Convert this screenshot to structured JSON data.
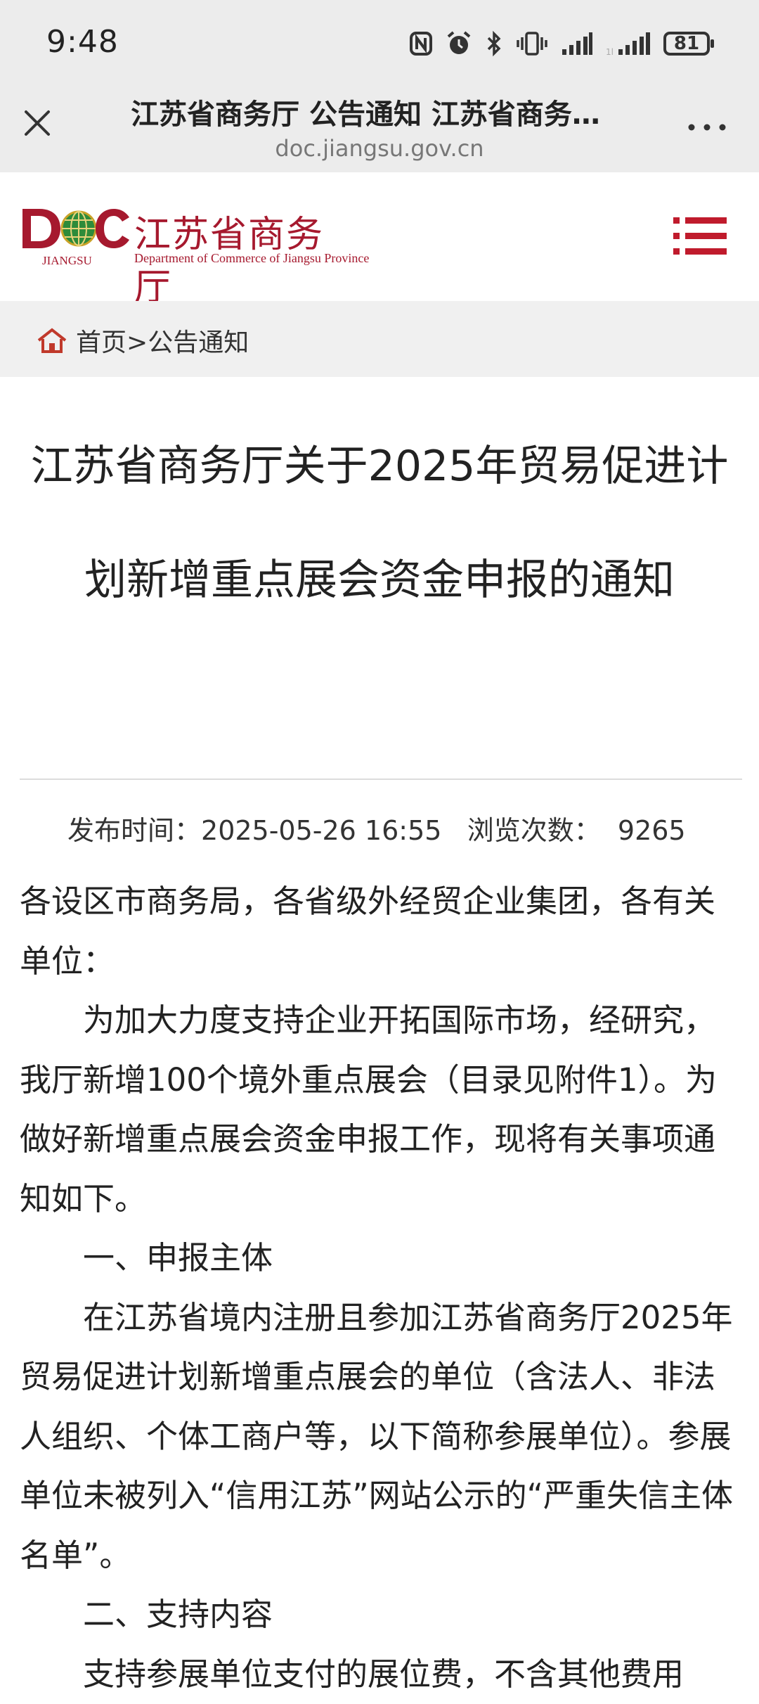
{
  "status": {
    "time": "9:48",
    "battery": "81"
  },
  "browser": {
    "title": "江苏省商务厅 公告通知 江苏省商务…",
    "url": "doc.jiangsu.gov.cn"
  },
  "site": {
    "logo_letters": "DOC",
    "logo_region": "JIANGSU",
    "name_cn": "江苏省商务厅",
    "name_en": "Department of Commerce of Jiangsu Province",
    "brand_color": "#a6192e"
  },
  "breadcrumb": {
    "home": "首页",
    "separator": ">",
    "current": "公告通知"
  },
  "article": {
    "title": "江苏省商务厅关于2025年贸易促进计划新增重点展会资金申报的通知",
    "publish_label": "发布时间：",
    "publish_time": "2025-05-26 16:55",
    "views_label": "浏览次数：",
    "views": "9265",
    "salutation": "各设区市商务局，各省级外经贸企业集团，各有关单位：",
    "p1": "为加大力度支持企业开拓国际市场，经研究，我厅新增100个境外重点展会（目录见附件1）。为做好新增重点展会资金申报工作，现将有关事项通知如下。",
    "h1": "一、申报主体",
    "p2": "在江苏省境内注册且参加江苏省商务厅2025年贸易促进计划新增重点展会的单位（含法人、非法人组织、个体工商户等，以下简称参展单位）。参展单位未被列入“信用江苏”网站公示的“严重失信主体名单”。",
    "h2": "二、支持内容",
    "p3_partial": "支持参展单位支付的展位费，不含其他费用"
  }
}
